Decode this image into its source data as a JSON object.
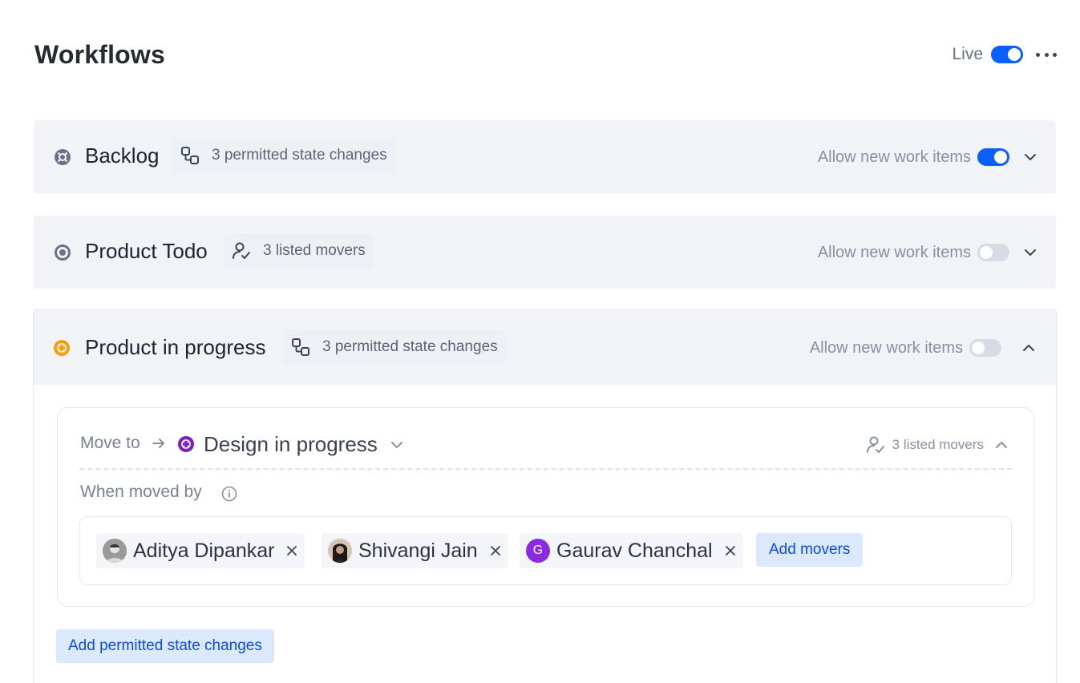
{
  "page": {
    "title": "Workflows",
    "live_label": "Live",
    "live_enabled": true,
    "more_icon": "more-horizontal-icon"
  },
  "colors": {
    "accent": "#0b5fff",
    "button_bg": "#dce8fc",
    "backlog_state": "#6b7386",
    "todo_state": "#6b7386",
    "in_progress_state": "#f5a00f",
    "design_state": "#7b22c7",
    "gaurav_avatar": "#8a2be2"
  },
  "states": [
    {
      "name": "Backlog",
      "icon": "backlog-state-icon",
      "chip_icon": "state-changes-icon",
      "chip_text": "3 permitted state changes",
      "allow_label": "Allow new work items",
      "allow_enabled": true,
      "expanded": false
    },
    {
      "name": "Product Todo",
      "icon": "todo-state-icon",
      "chip_icon": "user-check-icon",
      "chip_text": "3 listed movers",
      "allow_label": "Allow new work items",
      "allow_enabled": false,
      "expanded": false
    },
    {
      "name": "Product in progress",
      "icon": "in-progress-state-icon",
      "chip_icon": "state-changes-icon",
      "chip_text": "3 permitted state changes",
      "allow_label": "Allow new work items",
      "allow_enabled": false,
      "expanded": true
    }
  ],
  "transition": {
    "move_to_label": "Move to",
    "target_state": "Design in progress",
    "movers_summary": "3 listed movers",
    "moved_by_label": "When moved by",
    "movers": [
      {
        "name": "Aditya Dipankar",
        "avatar": "photo"
      },
      {
        "name": "Shivangi Jain",
        "avatar": "photo"
      },
      {
        "name": "Gaurav Chanchal",
        "avatar": "initial",
        "initial": "G"
      }
    ],
    "add_movers_label": "Add movers"
  },
  "add_state_changes_label": "Add permitted state changes"
}
